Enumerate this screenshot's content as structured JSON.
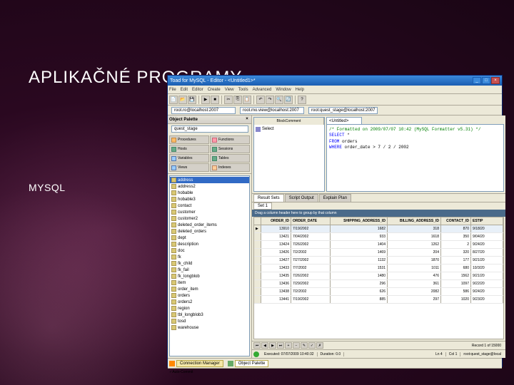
{
  "slide": {
    "title": "APLIKAČNÉ PROGRAMY",
    "subtitle": "MYSQL"
  },
  "window": {
    "title": "Toad for MySQL - Editor - <Untitled1>*",
    "menu": [
      "File",
      "Edit",
      "Editor",
      "Create",
      "View",
      "Tools",
      "Advanced",
      "Window",
      "Help"
    ]
  },
  "conn": {
    "box1": "root.ro@localhost:2007",
    "box2": "root.mo.view@localhost:2007",
    "box3": "root:quest_stage@localhost:2007"
  },
  "objpalette": {
    "title": "Object Palette",
    "combo": "quest_stage",
    "tabs": [
      {
        "id": "Procedures",
        "cls": "p"
      },
      {
        "id": "Functions",
        "cls": "f"
      },
      {
        "id": "Hosts",
        "cls": ""
      },
      {
        "id": "Sessions",
        "cls": ""
      },
      {
        "id": "Variables",
        "cls": "v"
      },
      {
        "id": "Tables",
        "cls": ""
      },
      {
        "id": "Views",
        "cls": "v"
      },
      {
        "id": "Indexes",
        "cls": "i"
      }
    ],
    "items": [
      "address",
      "address2",
      "hobable",
      "hobable3",
      "contact",
      "customer",
      "customer2",
      "deleted_order_items",
      "deleted_orders",
      "dept",
      "description",
      "doc",
      "fk",
      "fk_child",
      "fk_fail",
      "fk_longblob",
      "item",
      "order_item",
      "orders",
      "orders2",
      "region",
      "tbl_longblob3",
      "tosd",
      "warehouse"
    ]
  },
  "editor": {
    "tab": "<Untitled>",
    "side_tabs": [
      "BlockComment",
      "Select"
    ],
    "code": {
      "comment": "/* Formatted on 2009/07/07 10:42 (MySQL Formatter v5.31) */",
      "l1k": "SELECT",
      "l1t": " *",
      "l2k": "  FROM",
      "l2t": " orders",
      "l3k": " WHERE",
      "l3t": " order_date > 7 / 2 / 2002"
    }
  },
  "result": {
    "tabs": [
      "Result Sets",
      "Script Output",
      "Explain Plan"
    ],
    "subtab": "Set 1",
    "hint": "Drag a column header here to group by that column",
    "headers": [
      "ORDER_ID",
      "ORDER_DATE",
      "SHIPPING_ADDRESS_ID",
      "BILLING_ADDRESS_ID",
      "CONTACT_ID",
      "ESTIP"
    ],
    "rows": [
      [
        "13910",
        "7/19/2002",
        "1682",
        "318",
        "870",
        "9/18/20"
      ],
      [
        "13421",
        "7/04/2002",
        "933",
        "1618",
        "350",
        "9/04/20"
      ],
      [
        "13424",
        "7/26/2002",
        "1404",
        "1262",
        "2",
        "9/24/20"
      ],
      [
        "13426",
        "7/2/2002",
        "1469",
        "204",
        "320",
        "8/27/20"
      ],
      [
        "13427",
        "7/27/2002",
        "1132",
        "1870",
        "177",
        "9/21/20"
      ],
      [
        "13433",
        "7/7/2002",
        "1531",
        "1011",
        "680",
        "10/3/20"
      ],
      [
        "13435",
        "7/26/2002",
        "1480",
        "476",
        "1562",
        "9/21/20"
      ],
      [
        "13436",
        "7/29/2002",
        "296",
        "361",
        "1097",
        "9/22/20"
      ],
      [
        "13438",
        "7/2/2002",
        "626",
        "2082",
        "586",
        "9/24/20"
      ],
      [
        "13441",
        "7/19/2002",
        "885",
        "297",
        "1020",
        "9/23/20"
      ]
    ],
    "nav_record": "1",
    "record_count": "Record 1 of 15000"
  },
  "status": {
    "exec": "Executed:",
    "exec_time": "07/07/2009 10:40:32",
    "duration": "Duration:",
    "duration_val": "0.0",
    "ln": "Ln 4",
    "col": "Col 1",
    "conn": "root:quest_stage@local"
  },
  "bottom_tabs": {
    "cm": "Connection Manager",
    "op": "Object Palette"
  },
  "autocommit": "Auto-Commit"
}
